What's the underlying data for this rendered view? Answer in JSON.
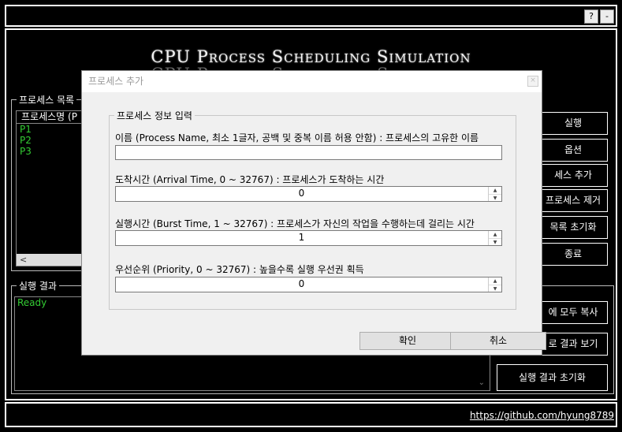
{
  "window": {
    "help_button": "?",
    "minimize_button": "-"
  },
  "app": {
    "title": "CPU Process Scheduling Simulation"
  },
  "process_list": {
    "group_label": "프로세스 목록",
    "column_header": "프로세스명 (P",
    "items": [
      "P1",
      "P2",
      "P3"
    ],
    "scroll_left": "<"
  },
  "side_buttons": [
    "실행",
    "옵션",
    "세스 추가",
    "프로세스 제거",
    "목록 초기화",
    "종료"
  ],
  "result": {
    "group_label": "실행 결과",
    "status": "Ready",
    "buttons": [
      "에 모두 복사",
      "로 결과 보기",
      "실행 결과 초기화"
    ]
  },
  "footer": {
    "link": "https://github.com/hyung8789"
  },
  "dialog": {
    "title": "프로세스 추가",
    "group_label": "프로세스 정보 입력",
    "name_label": "이름 (Process Name, 최소 1글자, 공백 및 중복 이름 허용 안함) : 프로세스의 고유한 이름",
    "name_value": "",
    "arrival_label": "도착시간 (Arrival Time, 0 ~ 32767) : 프로세스가 도착하는 시간",
    "arrival_value": "0",
    "burst_label": "실행시간 (Burst Time, 1 ~ 32767) : 프로세스가 자신의 작업을 수행하는데 걸리는 시간",
    "burst_value": "1",
    "priority_label": "우선순위 (Priority, 0 ~ 32767) : 높을수록 실행 우선권 획득",
    "priority_value": "0",
    "ok_button": "확인",
    "cancel_button": "취소"
  }
}
